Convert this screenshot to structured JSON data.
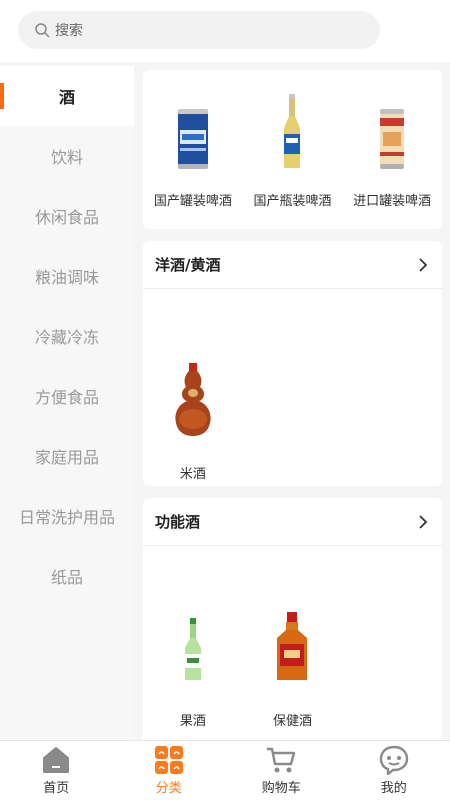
{
  "search": {
    "placeholder": "搜索"
  },
  "sidebar": {
    "items": [
      {
        "label": "酒",
        "active": true
      },
      {
        "label": "饮料"
      },
      {
        "label": "休闲食品"
      },
      {
        "label": "粮油调味"
      },
      {
        "label": "冷藏冷冻"
      },
      {
        "label": "方便食品"
      },
      {
        "label": "家庭用品"
      },
      {
        "label": "日常洗护用品"
      },
      {
        "label": "纸品"
      }
    ]
  },
  "sections": [
    {
      "title": "",
      "items": [
        {
          "label": "国产罐装啤酒",
          "icon": "beer-can-icon"
        },
        {
          "label": "国产瓶装啤酒",
          "icon": "beer-bottle-icon"
        },
        {
          "label": "进口罐装啤酒",
          "icon": "imported-beer-can-icon"
        }
      ]
    },
    {
      "title": "洋酒/黄酒",
      "items": [
        {
          "label": "米酒",
          "icon": "gourd-bottle-icon"
        }
      ]
    },
    {
      "title": "功能酒",
      "items": [
        {
          "label": "果酒",
          "icon": "fruit-wine-bottle-icon"
        },
        {
          "label": "保健酒",
          "icon": "health-wine-bottle-icon"
        }
      ]
    }
  ],
  "tabbar": {
    "items": [
      {
        "label": "首页",
        "icon": "home-icon"
      },
      {
        "label": "分类",
        "icon": "category-icon",
        "active": true
      },
      {
        "label": "购物车",
        "icon": "cart-icon"
      },
      {
        "label": "我的",
        "icon": "profile-icon"
      }
    ]
  },
  "colors": {
    "accent": "#ff7a1a",
    "indicator": "#ff6b0f",
    "page_bg": "#f5f5f5"
  }
}
